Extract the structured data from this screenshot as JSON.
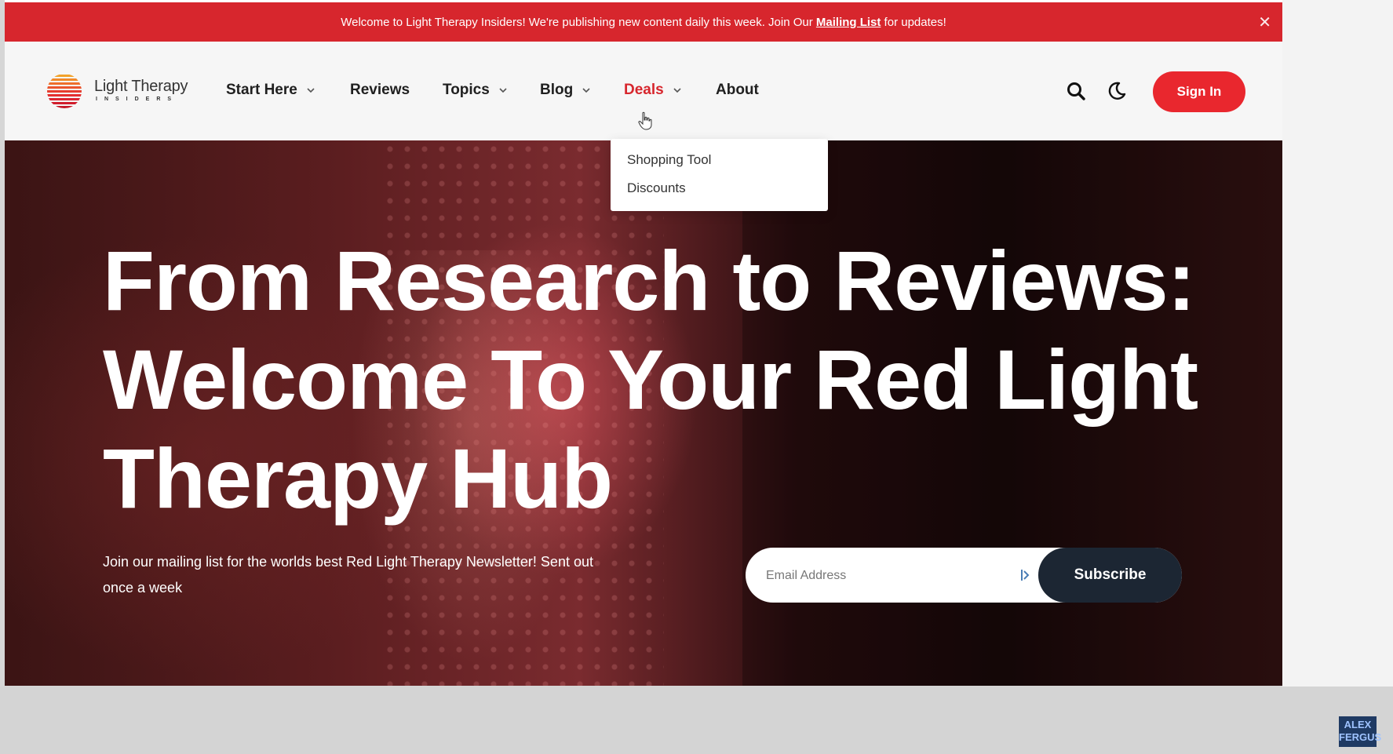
{
  "banner": {
    "text_before": "Welcome to Light Therapy Insiders! We're publishing new content daily this week. Join Our ",
    "link_text": "Mailing List",
    "text_after": " for updates!",
    "close_symbol": "✕"
  },
  "header": {
    "logo": {
      "brand": "Light Therapy",
      "sub": "INSIDERS"
    },
    "nav": {
      "start_here": "Start Here",
      "reviews": "Reviews",
      "topics": "Topics",
      "blog": "Blog",
      "deals": "Deals",
      "about": "About"
    },
    "icons": {
      "search": "search-icon",
      "theme": "moon-icon"
    },
    "sign_in": "Sign In"
  },
  "deals_menu": {
    "items": [
      "Shopping Tool",
      "Discounts"
    ]
  },
  "hero": {
    "title_lines": [
      "From Research to Reviews:",
      "Welcome To Your Red Light",
      "Therapy Hub"
    ],
    "subtitle": "Join our mailing list for the worlds best Red Light Therapy Newsletter! Sent out once a week",
    "email_placeholder": "Email Address",
    "subscribe_label": "Subscribe"
  },
  "watermark": {
    "line1": "ALEX",
    "line2": "FERGUS"
  },
  "colors": {
    "accent_red": "#d7262d",
    "button_red": "#e9272e",
    "subscribe_dark": "#1c2633"
  }
}
